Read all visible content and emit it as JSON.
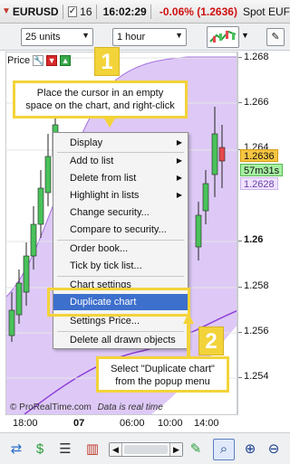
{
  "window": {
    "symbol": "EURUSD",
    "checkbox_label": "16",
    "time": "16:02:29",
    "change": "-0.06% (1.2636)",
    "spot": "Spot EUF"
  },
  "toolbar": {
    "units": "25 units",
    "timeframe": "1 hour",
    "tool_glyph": "✎"
  },
  "chart": {
    "panel_label": "Price",
    "watermark": "© ProRealTime.com",
    "realtime_note": "Data is real time",
    "y_ticks": [
      {
        "label": "1.268",
        "bold": false
      },
      {
        "label": "1.266",
        "bold": false
      },
      {
        "label": "1.264",
        "bold": false
      },
      {
        "label": "1.26",
        "bold": true
      },
      {
        "label": "1.258",
        "bold": false
      },
      {
        "label": "1.256",
        "bold": false
      },
      {
        "label": "1.254",
        "bold": false
      }
    ],
    "x_ticks": [
      {
        "label": "18:00",
        "bold": false
      },
      {
        "label": "07",
        "bold": true
      },
      {
        "label": "06:00",
        "bold": false
      },
      {
        "label": "10:00",
        "bold": false
      },
      {
        "label": "14:00",
        "bold": false
      }
    ],
    "badges": {
      "price": "1.2636",
      "countdown": "57m31s",
      "lower": "1.2628"
    },
    "colors": {
      "bull": "#49c25a",
      "bear": "#e5484d",
      "cloud": "#c89cf0",
      "cloud_line": "#9b59d0"
    }
  },
  "callouts": {
    "step1": "1",
    "step1_text_line1": "Place the cursor in an empty",
    "step1_text_line2": "space on the chart, and right-click",
    "step2": "2",
    "step2_text_line1": "Select \"Duplicate chart\"",
    "step2_text_line2": "from the popup menu"
  },
  "context_menu": {
    "items": [
      {
        "label": "Display",
        "submenu": true
      },
      {
        "label": "Add to list",
        "submenu": true
      },
      {
        "label": "Delete from list",
        "submenu": true
      },
      {
        "label": "Highlight in lists",
        "submenu": true
      },
      {
        "label": "Change security...",
        "submenu": false
      },
      {
        "label": "Compare to security...",
        "submenu": false
      },
      {
        "label": "Order book...",
        "submenu": false
      },
      {
        "label": "Tick by tick list...",
        "submenu": false
      },
      {
        "label": "Chart settings",
        "submenu": false
      },
      {
        "label": "Duplicate chart",
        "submenu": false,
        "selected": true
      },
      {
        "label": "Settings Price...",
        "submenu": false
      },
      {
        "label": "Delete all drawn objects",
        "submenu": false
      }
    ]
  }
}
